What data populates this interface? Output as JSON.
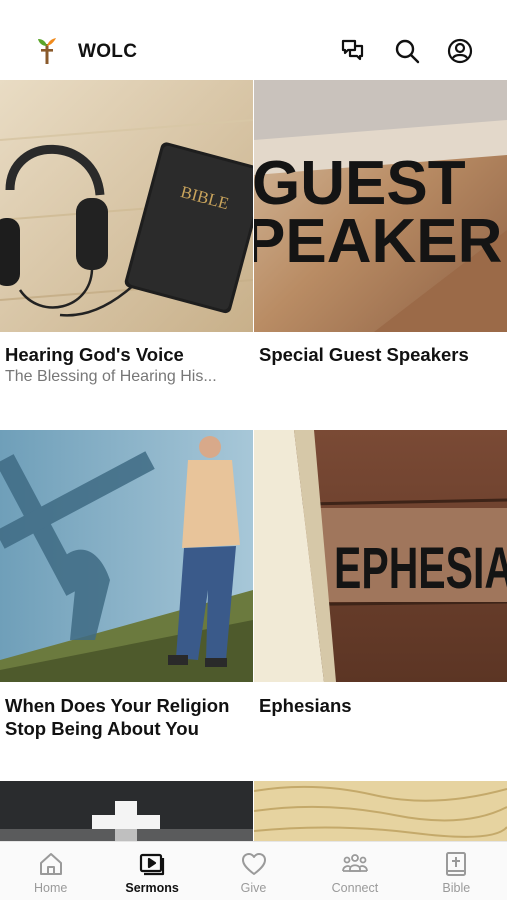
{
  "app": {
    "title": "WOLC",
    "logo_icon": "cross-sprout-logo"
  },
  "header_icons": [
    "chat-bubbles-icon",
    "search-icon",
    "account-circle-icon"
  ],
  "sermons": [
    {
      "title": "Hearing God's Voice",
      "subtitle": "The Blessing of Hearing His...",
      "thumb_text": "BIBLE"
    },
    {
      "title": "Special Guest Speakers",
      "subtitle": "",
      "thumb_text_line1": "GUEST",
      "thumb_text_line2": "PEAKER"
    },
    {
      "title": "When Does Your Religion Stop Being About You",
      "subtitle": ""
    },
    {
      "title": "Ephesians",
      "subtitle": "",
      "thumb_text": "EPHESIA"
    }
  ],
  "tabs": [
    {
      "label": "Home",
      "icon": "home-icon",
      "active": false
    },
    {
      "label": "Sermons",
      "icon": "video-library-icon",
      "active": true
    },
    {
      "label": "Give",
      "icon": "heart-icon",
      "active": false
    },
    {
      "label": "Connect",
      "icon": "people-group-icon",
      "active": false
    },
    {
      "label": "Bible",
      "icon": "bible-book-icon",
      "active": false
    }
  ],
  "colors": {
    "active_tab": "#111111",
    "inactive_tab": "#9a9a9a",
    "subtitle": "#777777"
  }
}
